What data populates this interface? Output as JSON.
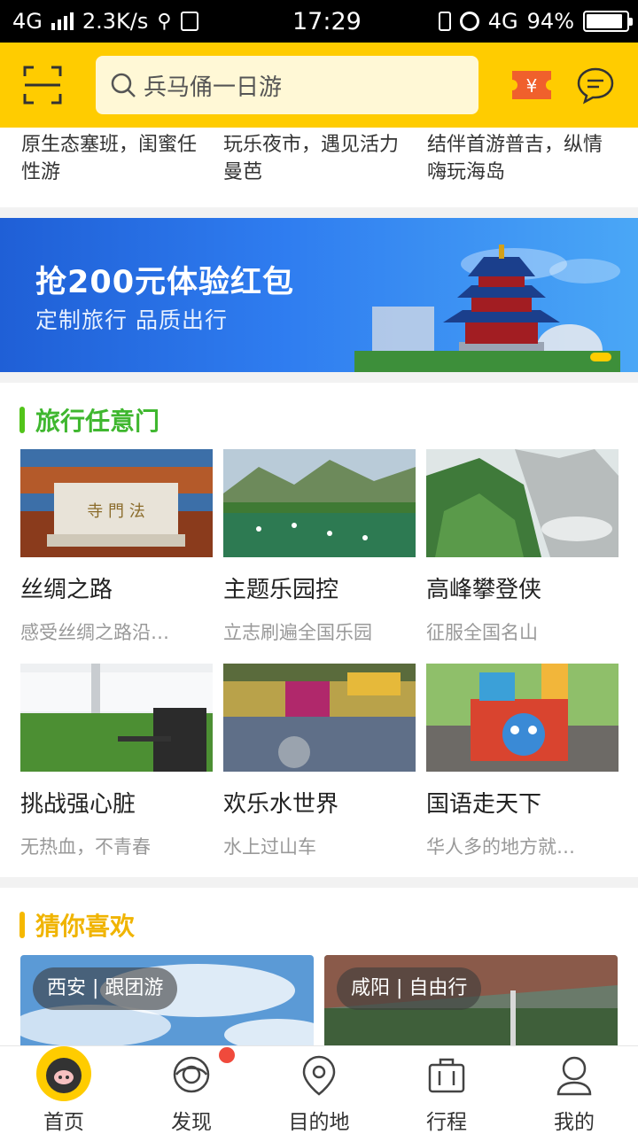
{
  "status_bar": {
    "network": "4G",
    "speed": "2.3K/s",
    "time": "17:29",
    "network2": "4G",
    "battery": "94%"
  },
  "header": {
    "search_placeholder": "兵马俑一日游"
  },
  "top_strip": {
    "items": [
      {
        "text": "原生态塞班，闺蜜任性游"
      },
      {
        "text": "玩乐夜市，遇见活力曼芭"
      },
      {
        "text": "结伴首游普吉，纵情嗨玩海岛"
      }
    ]
  },
  "banner": {
    "title": "抢200元体验红包",
    "subtitle": "定制旅行 品质出行"
  },
  "section_travel": {
    "title": "旅行任意门",
    "accent": "#52c41a",
    "cards": [
      {
        "name": "丝绸之路",
        "desc": "感受丝绸之路沿…"
      },
      {
        "name": "主题乐园控",
        "desc": "立志刷遍全国乐园"
      },
      {
        "name": "高峰攀登侠",
        "desc": "征服全国名山"
      },
      {
        "name": "挑战强心脏",
        "desc": "无热血，不青春"
      },
      {
        "name": "欢乐水世界",
        "desc": "水上过山车"
      },
      {
        "name": "国语走天下",
        "desc": "华人多的地方就…"
      }
    ]
  },
  "section_like": {
    "title": "猜你喜欢",
    "accent": "#f5b800",
    "items": [
      {
        "tag": "西安 | 跟团游"
      },
      {
        "tag": "咸阳 | 自由行"
      }
    ]
  },
  "tabbar": {
    "tabs": [
      {
        "label": "首页",
        "icon": "pig-logo-icon"
      },
      {
        "label": "发现",
        "icon": "eye-icon"
      },
      {
        "label": "目的地",
        "icon": "location-pin-icon"
      },
      {
        "label": "行程",
        "icon": "suitcase-icon"
      },
      {
        "label": "我的",
        "icon": "user-icon"
      }
    ]
  }
}
